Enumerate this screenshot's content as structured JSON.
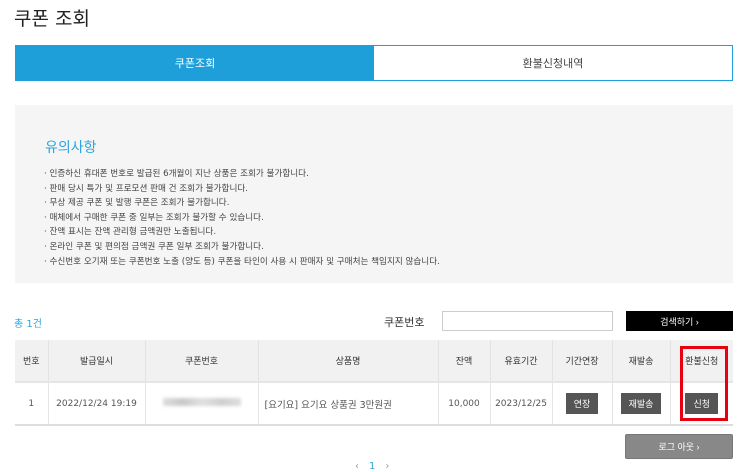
{
  "title": "쿠폰 조회",
  "tabs": [
    {
      "label": "쿠폰조회"
    },
    {
      "label": "환불신청내역"
    }
  ],
  "notice": {
    "heading": "유의사항",
    "items": [
      "· 인증하신 휴대폰 번호로 발급된 6개월이 지난 상품은 조회가 불가합니다.",
      "· 판매 당시 특가 및 프로모션 판매 건 조회가 불가합니다.",
      "· 무상 제공 쿠폰 및 발행 쿠폰은 조회가 불가합니다.",
      "· 매체에서 구매한 쿠폰 중 일부는 조회가 불가할 수 있습니다.",
      "· 잔액 표시는 잔액 관리형 금액권만 노출됩니다.",
      "· 온라인 쿠폰 및 편의점 금액권 쿠폰 일부 조회가 불가합니다.",
      "· 수신번호 오기재 또는 쿠폰번호 노출 (양도 등) 쿠폰을 타인이 사용 시 판매자 및 구매처는 책임지지 않습니다."
    ]
  },
  "search": {
    "count": "총 1건",
    "label": "쿠폰번호",
    "value": "",
    "button": "검색하기 ›"
  },
  "table": {
    "headers": [
      "번호",
      "발급일시",
      "쿠폰번호",
      "상품명",
      "잔액",
      "유효기간",
      "기간연장",
      "재발송",
      "환불신청"
    ],
    "rows": [
      {
        "no": "1",
        "issued": "2022/12/24 19:19",
        "product": "[요기요] 요기요 상품권 3만원권",
        "balance": "10,000",
        "expiry": "2023/12/25",
        "extend": "연장",
        "resend": "재발송",
        "refund": "신청"
      }
    ]
  },
  "logout": "로그 아웃 ›",
  "pager": {
    "prev": "‹",
    "current": "1",
    "next": "›"
  },
  "colors": {
    "accent": "#1e9fd9",
    "highlight": "#e60012"
  }
}
